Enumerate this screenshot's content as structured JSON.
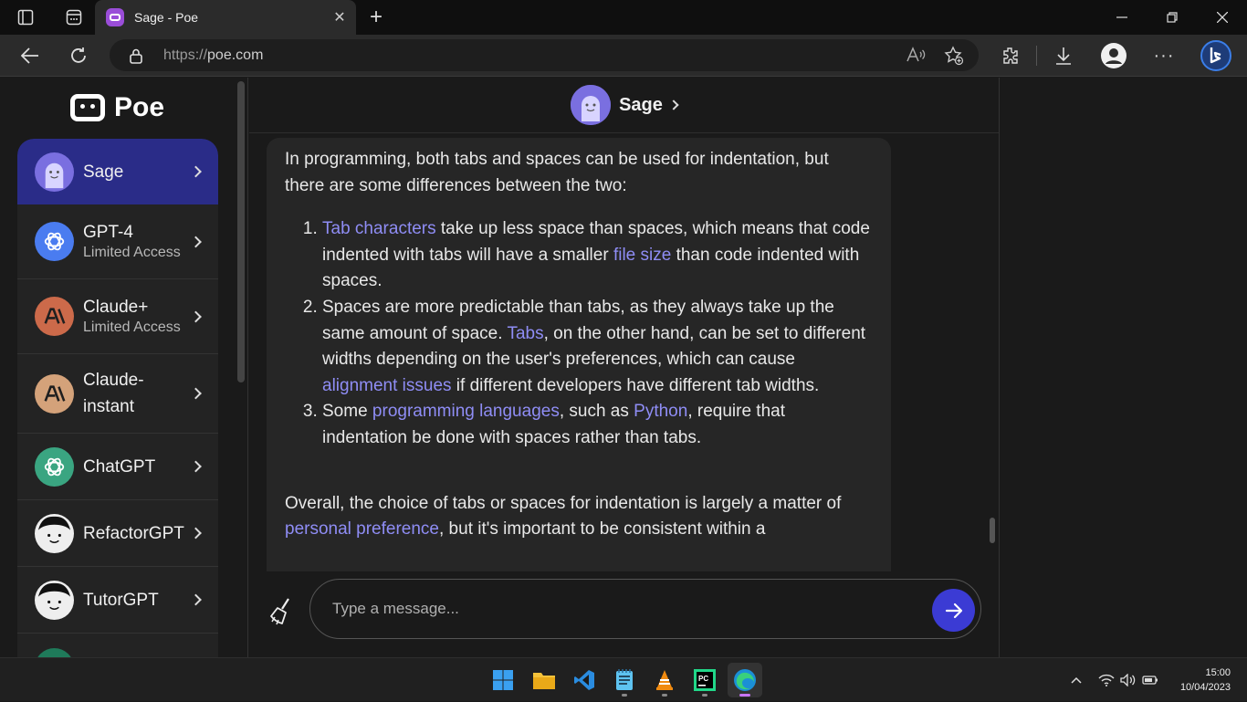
{
  "browser": {
    "tab_title": "Sage - Poe",
    "url_prefix": "https://",
    "url_host": "poe.com"
  },
  "sidebar": {
    "logo_text": "Poe",
    "bots": [
      {
        "name": "Sage",
        "sub": "",
        "avatar": "sage-avatar",
        "color": "#7a6fe0",
        "active": true
      },
      {
        "name": "GPT-4",
        "sub": "Limited Access",
        "avatar": "gpt4-avatar",
        "color": "#4a7cf0",
        "active": false
      },
      {
        "name": "Claude+",
        "sub": "Limited Access",
        "avatar": "claude-plus-avatar",
        "color": "#cc6a4a",
        "active": false
      },
      {
        "name": "Claude-instant",
        "sub": "",
        "avatar": "claude-instant-avatar",
        "color": "#d4a27a",
        "active": false
      },
      {
        "name": "ChatGPT",
        "sub": "",
        "avatar": "chatgpt-avatar",
        "color": "#3aa581",
        "active": false
      },
      {
        "name": "RefactorGPT",
        "sub": "",
        "avatar": "refactorgpt-avatar",
        "color": "#eeeeee",
        "active": false
      },
      {
        "name": "TutorGPT",
        "sub": "",
        "avatar": "tutorgpt-avatar",
        "color": "#eeeeee",
        "active": false
      }
    ]
  },
  "chat": {
    "bot_name": "Sage",
    "intro": "In programming, both tabs and spaces can be used for indentation, but there are some differences between the two:",
    "items": [
      {
        "link1": "Tab characters",
        "t1": " take up less space than spaces, which means that code indented with tabs will have a smaller ",
        "link2": "file size",
        "t2": " than code indented with spaces."
      },
      {
        "t0": "Spaces are more predictable than tabs, as they always take up the same amount of space. ",
        "link1": "Tabs",
        "t1": ", on the other hand, can be set to different widths depending on the user's preferences, which can cause ",
        "link2": "alignment issues",
        "t2": " if different developers have different tab widths."
      },
      {
        "t0": "Some ",
        "link1": "programming languages",
        "t1": ", such as ",
        "link2": "Python",
        "t2": ", require that indentation be done with spaces rather than tabs."
      }
    ],
    "outro_t0": "Overall, the choice of tabs or spaces for indentation is largely a matter of ",
    "outro_link": "personal preference",
    "outro_t1": ", but it's important to be consistent within a",
    "input_placeholder": "Type a message..."
  },
  "taskbar": {
    "time": "15:00",
    "date": "10/04/2023",
    "apps": [
      "start-icon",
      "file-explorer-icon",
      "vscode-icon",
      "notepad-icon",
      "vlc-icon",
      "pycharm-icon",
      "edge-icon"
    ]
  },
  "colors": {
    "accent": "#3b3bd4",
    "active_bot": "#2a2c88",
    "link": "#8f8df5"
  }
}
